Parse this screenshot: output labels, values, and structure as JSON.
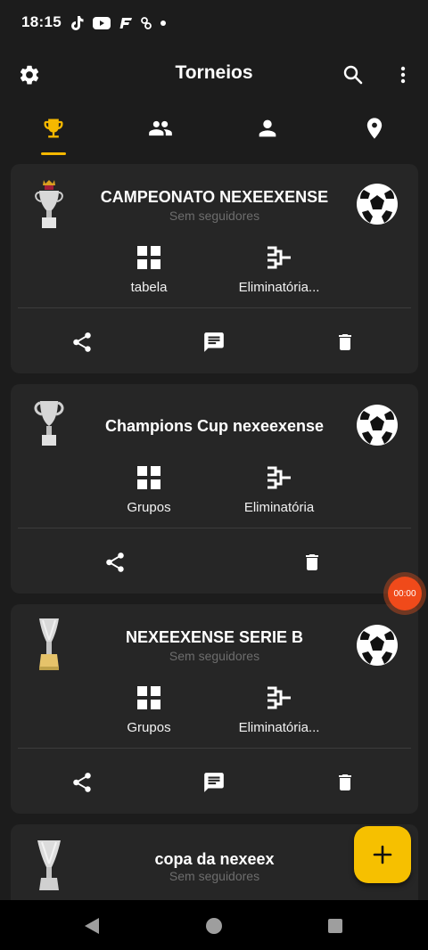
{
  "status_bar": {
    "time": "18:15"
  },
  "app_bar": {
    "title": "Torneios"
  },
  "tabs": [
    "trophy-icon",
    "group-icon",
    "person-icon",
    "location-icon"
  ],
  "cards": [
    {
      "title": "CAMPEONATO NEXEEXENSE",
      "subtitle": "Sem seguidores",
      "option1": "tabela",
      "option2": "Eliminatória..."
    },
    {
      "title": "Champions Cup nexeexense",
      "subtitle": "",
      "option1": "Grupos",
      "option2": "Eliminatória"
    },
    {
      "title": "NEXEEXENSE SERIE B",
      "subtitle": "Sem seguidores",
      "option1": "Grupos",
      "option2": "Eliminatória..."
    },
    {
      "title": "copa da nexeex",
      "subtitle": "Sem seguidores"
    }
  ],
  "recorder": {
    "label": "00:00"
  },
  "colors": {
    "accent": "#f5b800",
    "background": "#1c1c1c",
    "card": "#262626",
    "recorder": "#f04a1a"
  }
}
